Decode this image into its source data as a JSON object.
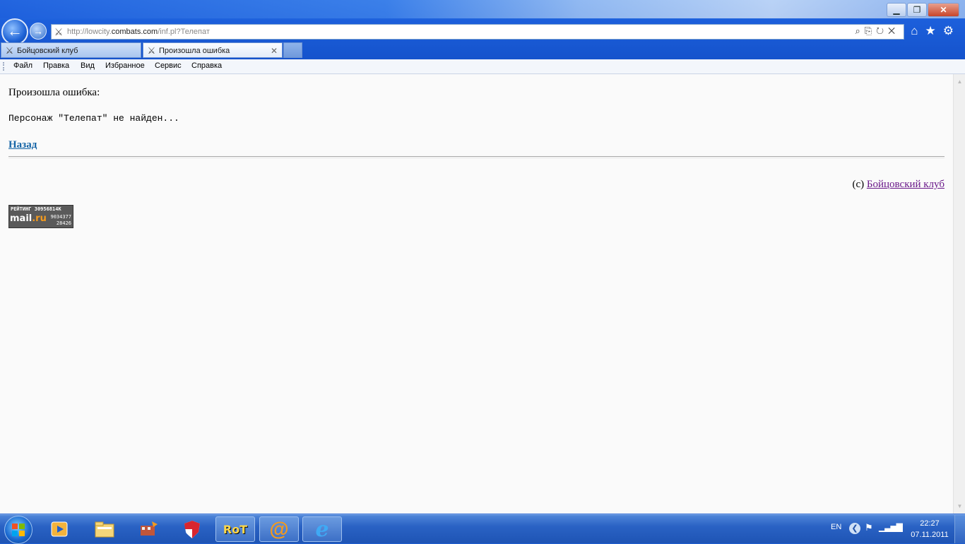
{
  "browser": {
    "address": {
      "prefix": "http://lowcity.",
      "domain": "combats.com",
      "path": "/inf.pl?Телепат"
    },
    "window_buttons": {
      "minimize": "▁",
      "restore": "❐",
      "close": "✕"
    },
    "tabs": [
      {
        "label": "Бойцовский клуб",
        "active": false
      },
      {
        "label": "Произошла ошибка",
        "active": true
      }
    ],
    "tab_close": "✕",
    "menu": [
      "Файл",
      "Правка",
      "Вид",
      "Избранное",
      "Сервис",
      "Справка"
    ],
    "toolbar_icons": [
      "home-icon",
      "star-icon",
      "gear-icon"
    ]
  },
  "page": {
    "error_title": "Произошла ошибка:",
    "error_message": "Персонаж \"Телепат\" не найден...",
    "back_link": "Назад",
    "copyright_prefix": "(c)",
    "copyright_link": "Бойцовский клуб",
    "counter": {
      "label": "РЕЙТИНГ",
      "total": "30956814K",
      "brand_left": "mail",
      "brand_right": ".ru",
      "value2": "9034377",
      "value3": "28426"
    }
  },
  "taskbar": {
    "lang": "EN",
    "time": "22:27",
    "date": "07.11.2011",
    "pinned": [
      "media-player-icon",
      "explorer-icon",
      "game-icon",
      "shield-icon",
      "rot-icon",
      "mail-agent-icon",
      "internet-explorer-icon"
    ],
    "pinned_labels": {
      "rot": "RoT",
      "mail": "@",
      "ie": "e"
    }
  }
}
